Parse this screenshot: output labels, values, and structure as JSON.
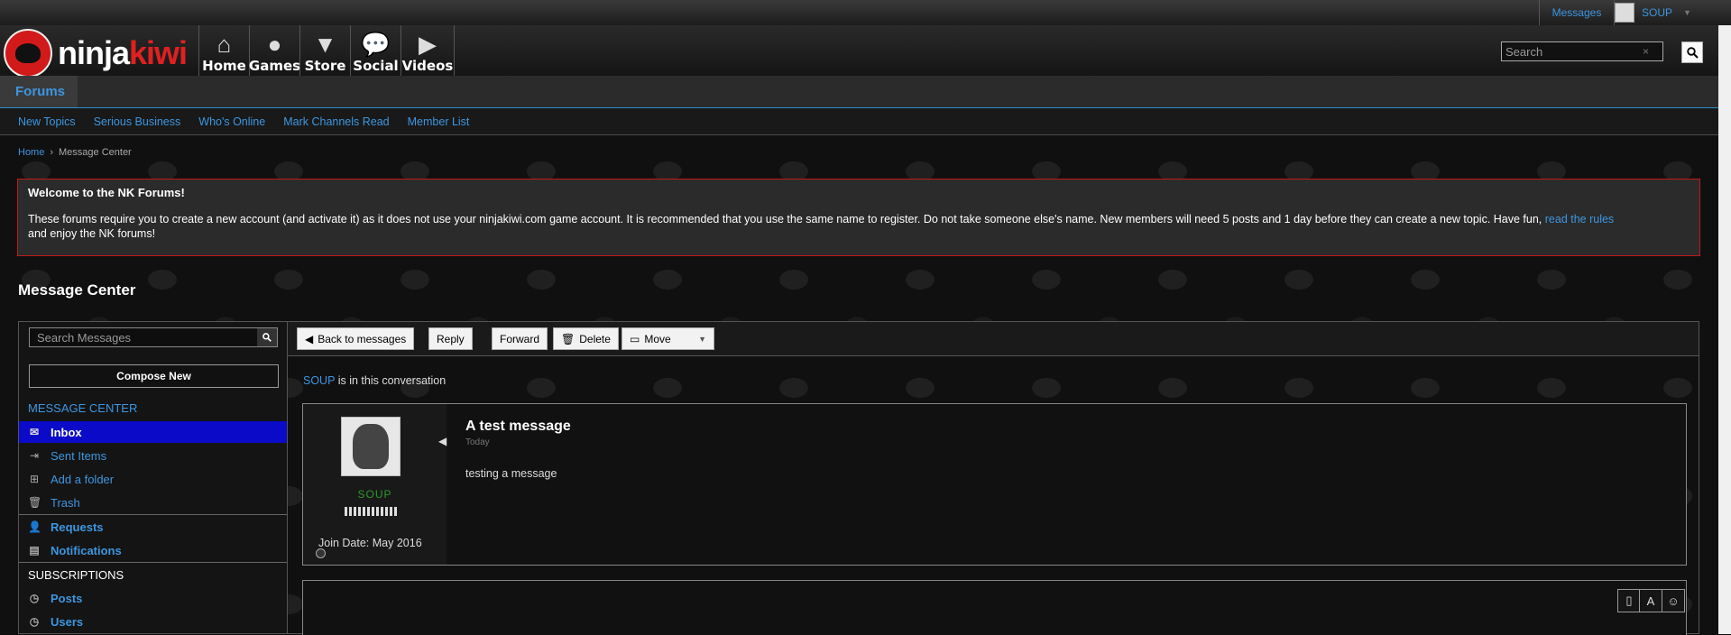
{
  "topbar": {
    "messages_label": "Messages",
    "username": "SOUP",
    "caret": "▼"
  },
  "header": {
    "logo_ninja": "ninja",
    "logo_kiwi": "kiwi",
    "nav": [
      {
        "label": "Home",
        "icon": "home-icon"
      },
      {
        "label": "Games",
        "icon": "balloon-icon"
      },
      {
        "label": "Store",
        "icon": "shirt-icon"
      },
      {
        "label": "Social",
        "icon": "chat-icon"
      },
      {
        "label": "Videos",
        "icon": "play-icon"
      }
    ],
    "search_placeholder": "Search",
    "search_clear": "×"
  },
  "tabbar": {
    "active_tab": "Forums"
  },
  "subnav": [
    "New Topics",
    "Serious Business",
    "Who's Online",
    "Mark Channels Read",
    "Member List"
  ],
  "breadcrumb": {
    "home": "Home",
    "current": "Message Center"
  },
  "notice": {
    "title": "Welcome to the NK Forums!",
    "text": "These forums require you to create a new account (and activate it) as it does not use your ninjakiwi.com game account. It is recommended that you use the same name to register. Do not take someone else's name. New members will need 5 posts and 1 day before they can create a new topic. Have fun, ",
    "link": "read the rules",
    "text_end": "and enjoy the NK forums!"
  },
  "page_title": "Message Center",
  "sidebar": {
    "search_placeholder": "Search Messages",
    "compose_label": "Compose New",
    "message_center_heading": "MESSAGE CENTER",
    "folders": [
      {
        "label": "Inbox",
        "icon": "inbox-icon",
        "active": true
      },
      {
        "label": "Sent Items",
        "icon": "sent-icon"
      },
      {
        "label": "Add a folder",
        "icon": "add-folder-icon"
      },
      {
        "label": "Trash",
        "icon": "trash-icon"
      }
    ],
    "extras": [
      {
        "label": "Requests",
        "icon": "user-icon"
      },
      {
        "label": "Notifications",
        "icon": "document-icon"
      }
    ],
    "subscriptions_heading": "SUBSCRIPTIONS",
    "subscriptions": [
      {
        "label": "Posts",
        "icon": "clock-icon"
      },
      {
        "label": "Users",
        "icon": "clock-icon"
      }
    ]
  },
  "toolbar": {
    "back": "Back to messages",
    "reply": "Reply",
    "forward": "Forward",
    "delete": "Delete",
    "move": "Move"
  },
  "conversation": {
    "user": "SOUP",
    "suffix": "is in this conversation"
  },
  "message": {
    "author": "SOUP",
    "join_date": "Join Date: May 2016",
    "title": "A test message",
    "date": "Today",
    "body": "testing a message"
  },
  "colors": {
    "accent": "#3d96e0",
    "active": "#0a0ac8",
    "notice_border": "#c01919",
    "username": "#2a9a2a"
  }
}
